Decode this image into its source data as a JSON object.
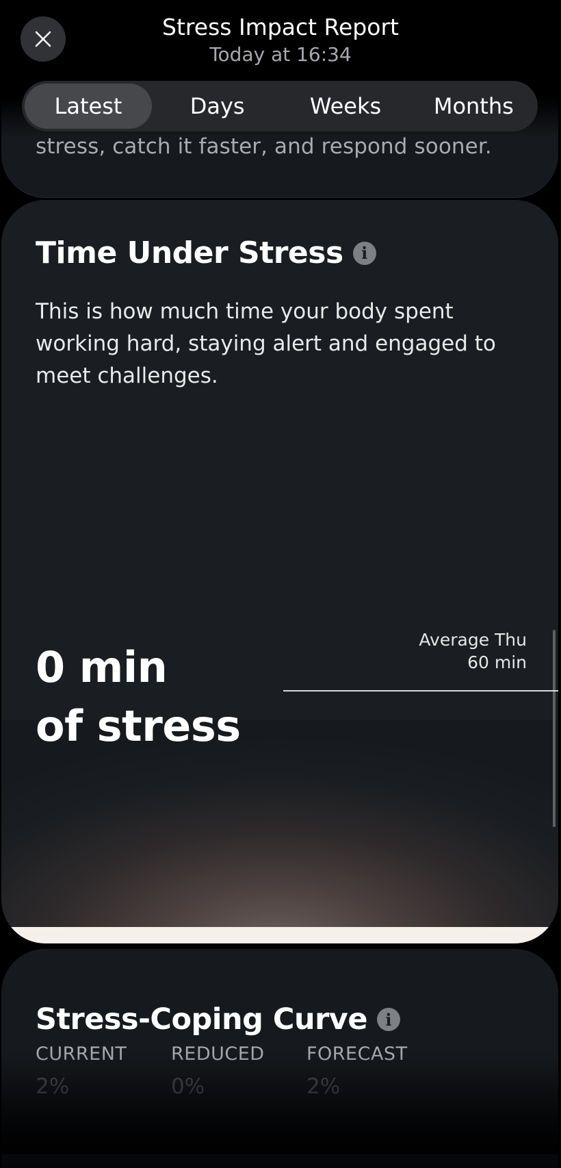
{
  "header": {
    "title": "Stress Impact Report",
    "subtitle": "Today at 16:34",
    "tabs": [
      {
        "label": "Latest",
        "active": true
      },
      {
        "label": "Days",
        "active": false
      },
      {
        "label": "Weeks",
        "active": false
      },
      {
        "label": "Months",
        "active": false
      }
    ],
    "close_icon": "close-icon"
  },
  "previous_card": {
    "text": "stress, catch it faster, and respond sooner."
  },
  "time_under_stress": {
    "title": "Time Under Stress",
    "info_icon": "info-icon",
    "description": "This is how much time your body spent working hard, staying alert and engaged to meet challenges.",
    "value_line1": "0 min",
    "value_line2": "of stress",
    "average_label": "Average Thu",
    "average_value": "60 min"
  },
  "stress_coping_curve": {
    "title": "Stress-Coping Curve",
    "info_icon": "info-icon",
    "metrics": [
      {
        "label": "CURRENT",
        "value": "2%"
      },
      {
        "label": "REDUCED",
        "value": "0%"
      },
      {
        "label": "FORECAST",
        "value": "2%"
      }
    ]
  },
  "colors": {
    "background": "#000000",
    "card": "#1a1d21",
    "glow": "#6b5e5c",
    "fill_strip": "#f6f0eb"
  }
}
